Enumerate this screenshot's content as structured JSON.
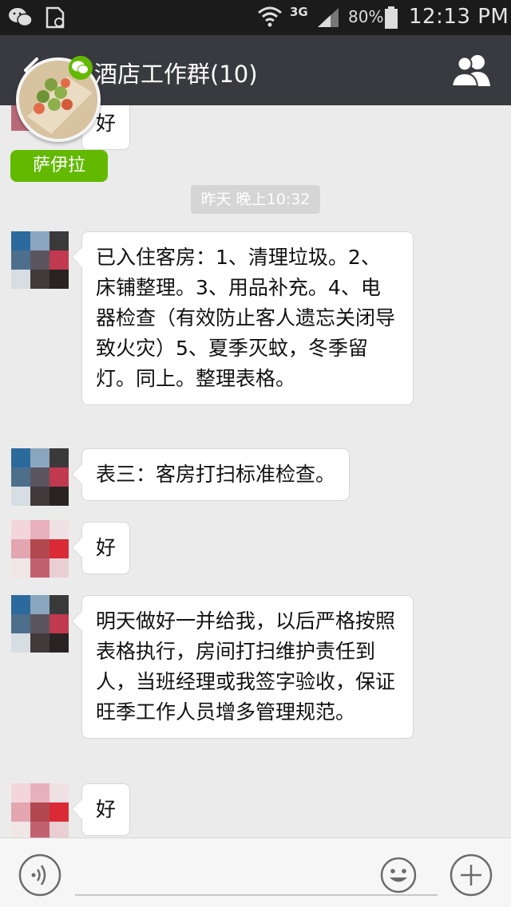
{
  "status_bar": {
    "network": "3G",
    "battery": "80%",
    "time": "12:13 PM"
  },
  "header": {
    "title": "酒店工作群(10)"
  },
  "floating_bubble": {
    "name": "萨伊拉"
  },
  "chat": {
    "timestamp": "昨天 晚上10:32",
    "messages": [
      {
        "text": "好"
      },
      {
        "text": "已入住客房：1、清理垃圾。2、床铺整理。3、用品补充。4、电器检查（有效防止客人遗忘关闭导致火灾）5、夏季灭蚊，冬季留灯。同上。整理表格。"
      },
      {
        "text": "表三：客房打扫标准检查。"
      },
      {
        "text": "好"
      },
      {
        "text": "明天做好一并给我，以后严格按照表格执行，房间打扫维护责任到人，当班经理或我签字验收，保证旺季工作人员增多管理规范。"
      },
      {
        "text": "好"
      }
    ]
  },
  "colors": {
    "title_bar": "#393a3f",
    "chat_background": "#ebebeb",
    "wechat_green": "#62b900",
    "status_bar": "#1b1b1b"
  },
  "icons": {
    "back": "back-arrow-icon",
    "members": "group-members-icon",
    "voice": "voice-icon",
    "emoji": "emoji-icon",
    "plus": "plus-icon"
  }
}
